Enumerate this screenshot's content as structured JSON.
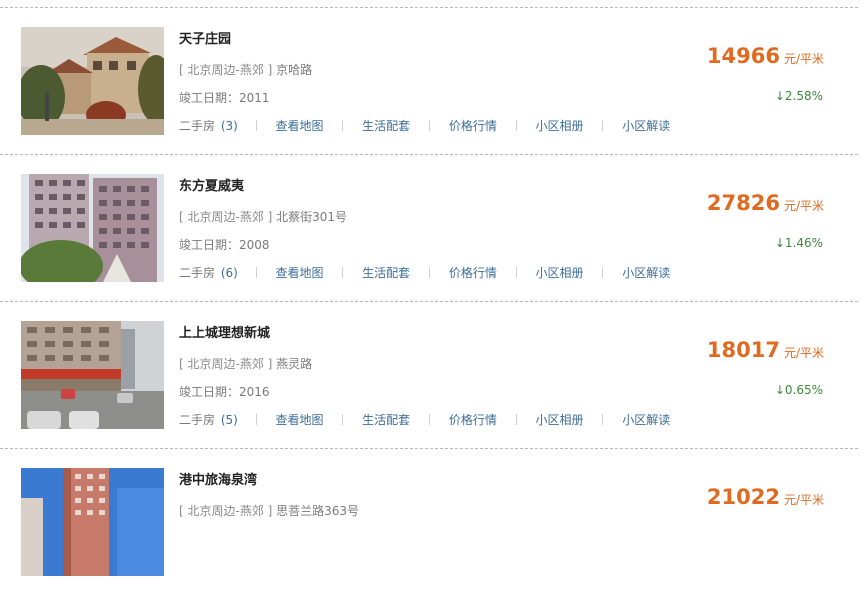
{
  "listings": [
    {
      "name": "天子庄园",
      "address_prefix": "[ 北京周边-燕郊 ]",
      "address": "京哈路",
      "built_label": "竣工日期：",
      "built_year": "2011",
      "second_hand_label": "二手房",
      "second_hand_count": "(3)",
      "links": [
        "查看地图",
        "生活配套",
        "价格行情",
        "小区相册",
        "小区解读"
      ],
      "price": "14966",
      "price_unit": "元/平米",
      "change": "↓2.58%"
    },
    {
      "name": "东方夏威夷",
      "address_prefix": "[ 北京周边-燕郊 ]",
      "address": "北蔡街301号",
      "built_label": "竣工日期：",
      "built_year": "2008",
      "second_hand_label": "二手房",
      "second_hand_count": "(6)",
      "links": [
        "查看地图",
        "生活配套",
        "价格行情",
        "小区相册",
        "小区解读"
      ],
      "price": "27826",
      "price_unit": "元/平米",
      "change": "↓1.46%"
    },
    {
      "name": "上上城理想新城",
      "address_prefix": "[ 北京周边-燕郊 ]",
      "address": "燕灵路",
      "built_label": "竣工日期：",
      "built_year": "2016",
      "second_hand_label": "二手房",
      "second_hand_count": "(5)",
      "links": [
        "查看地图",
        "生活配套",
        "价格行情",
        "小区相册",
        "小区解读"
      ],
      "price": "18017",
      "price_unit": "元/平米",
      "change": "↓0.65%"
    },
    {
      "name": "港中旅海泉湾",
      "address_prefix": "[ 北京周边-燕郊 ]",
      "address": "思菩兰路363号",
      "price": "21022",
      "price_unit": "元/平米"
    }
  ]
}
